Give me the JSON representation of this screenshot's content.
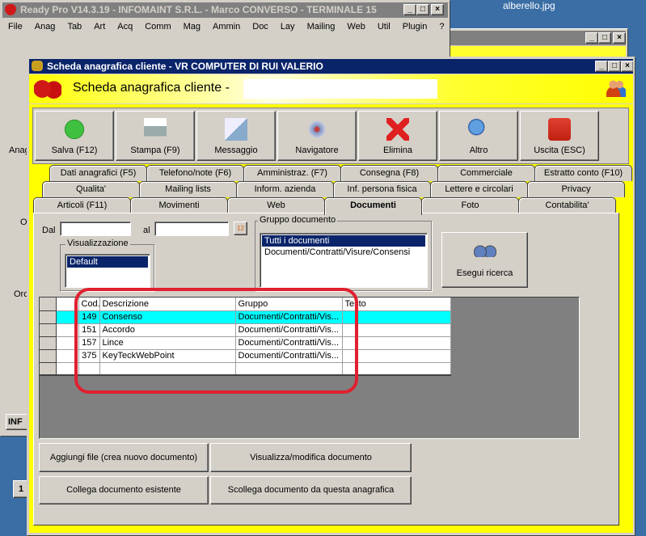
{
  "desktop": {
    "file_label": "alberello.jpg"
  },
  "main_window": {
    "title": "Ready Pro V14.3.19 - INFOMAINT S.R.L. - Marco CONVERSO - TERMINALE 15",
    "menu": [
      "File",
      "Anag",
      "Tab",
      "Art",
      "Acq",
      "Comm",
      "Mag",
      "Ammin",
      "Doc",
      "Lay",
      "Mailing",
      "Web",
      "Util",
      "Plugin",
      "?"
    ],
    "side_labels": [
      "Anag",
      "O",
      "Orc"
    ],
    "status": "INF",
    "bottom_label": "1"
  },
  "dialog": {
    "title": "Scheda anagrafica cliente - VR COMPUTER DI RUI VALERIO",
    "header": "Scheda anagrafica cliente - ",
    "toolbar": [
      {
        "label": "Salva (F12)",
        "icon": "check-icon"
      },
      {
        "label": "Stampa (F9)",
        "icon": "printer-icon"
      },
      {
        "label": "Messaggio",
        "icon": "message-icon"
      },
      {
        "label": "Navigatore",
        "icon": "compass-icon"
      },
      {
        "label": "Elimina",
        "icon": "delete-icon"
      },
      {
        "label": "Altro",
        "icon": "search-icon"
      },
      {
        "label": "Uscita (ESC)",
        "icon": "power-icon"
      }
    ],
    "tabs_row1": [
      "Dati anagrafici (F5)",
      "Telefono/note (F6)",
      "Amministraz. (F7)",
      "Consegna (F8)",
      "Commerciale",
      "Estratto conto (F10)"
    ],
    "tabs_row2": [
      "Qualita'",
      "Mailing lists",
      "Inform. azienda",
      "Inf. persona fisica",
      "Lettere e circolari",
      "Privacy"
    ],
    "tabs_row3": [
      "Articoli (F11)",
      "Movimenti",
      "Web",
      "Documenti",
      "Foto",
      "Contabilita'"
    ],
    "active_tab": "Documenti",
    "filters": {
      "dal_label": "Dal",
      "dal_value": "",
      "al_label": "al",
      "al_value": "",
      "visualizzazione_label": "Visualizzazione",
      "visualizzazione_options": [
        "Default"
      ],
      "gruppo_label": "Gruppo documento",
      "gruppo_options": [
        "Tutti i documenti",
        "Documenti/Contratti/Visure/Consensi"
      ],
      "search_button": "Esegui ricerca"
    },
    "table": {
      "columns": [
        "Cod.",
        "Descrizione",
        "Gruppo",
        "Testo"
      ],
      "rows": [
        {
          "cod": "149",
          "descrizione": "Consenso",
          "gruppo": "Documenti/Contratti/Vis...",
          "testo": ""
        },
        {
          "cod": "151",
          "descrizione": "Accordo",
          "gruppo": "Documenti/Contratti/Vis...",
          "testo": ""
        },
        {
          "cod": "157",
          "descrizione": "Lince",
          "gruppo": "Documenti/Contratti/Vis...",
          "testo": ""
        },
        {
          "cod": "375",
          "descrizione": "KeyTeckWebPoint",
          "gruppo": "Documenti/Contratti/Vis...",
          "testo": ""
        }
      ]
    },
    "buttons": {
      "add": "Aggiungi file (crea nuovo documento)",
      "view": "Visualizza/modifica documento",
      "link": "Collega documento esistente",
      "unlink": "Scollega documento da questa anagrafica"
    }
  },
  "colors": {
    "desktop": "#3a6ea5",
    "active_title": "#0a246a",
    "highlight_row": "#00ffff",
    "annotation": "#e02030",
    "header_yellow": "#ffff00"
  }
}
